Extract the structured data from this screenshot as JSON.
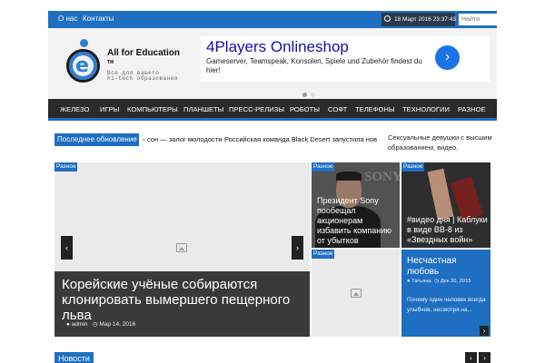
{
  "topbar": {
    "links": [
      "О нас",
      "Контакты"
    ],
    "datetime": "18 Март 2016 23:37:43",
    "search_placeholder": "Найти"
  },
  "logo": {
    "name": "All for Education",
    "tm": "TM",
    "tagline_1": "Все для вашего",
    "tagline_2": "hi-tech образования"
  },
  "ad": {
    "title": "4Players Onlineshop",
    "text": "Gameserver, Teamspeak, Konsolen, Spiele und Zubehör findest du hier!",
    "button": "›"
  },
  "nav": {
    "items": [
      "Железо",
      "Игры",
      "Компьютеры",
      "Планшеты",
      "Пресс-релизы",
      "Роботы",
      "Софт",
      "Телефоны",
      "Технологии",
      "Разное"
    ]
  },
  "latest": {
    "label": "Последнее обновление",
    "items": [
      "сон — залог молодости",
      "Российская команда Black Desert запустила новый он"
    ]
  },
  "promo": {
    "text": "Сексуальные девушки с высшим образованием, видео."
  },
  "featured": {
    "badge": "Разное",
    "title": "Корейские учёные собираются клонировать вымершего пещерного льва",
    "author": "admin",
    "date": "Мар 14, 2016"
  },
  "cards": {
    "sony": {
      "badge": "Разное",
      "title": "Президент Sony пообещал акционерам избавить компанию от убытков",
      "bg_logo": "SONY"
    },
    "shoe": {
      "badge": "Разное",
      "title": "#видео дня | Каблуки в виде BB-8 из «Звездных войн»"
    },
    "blank": {
      "badge": "Разное"
    },
    "love": {
      "title": "Несчастная любовь",
      "author": "Татьяна",
      "date": "Дек 20, 2015",
      "excerpt": "Почему один человек всегда улыбчив, несмотря на..."
    }
  },
  "news": {
    "label": "Новости"
  },
  "icons": {
    "arrow_left": "‹",
    "arrow_right": "›",
    "user": "user-icon",
    "clock": "clock-icon",
    "image": "image-placeholder-icon"
  },
  "colors": {
    "accent": "#1e6fc2",
    "nav_bg": "#2b2b2b"
  }
}
